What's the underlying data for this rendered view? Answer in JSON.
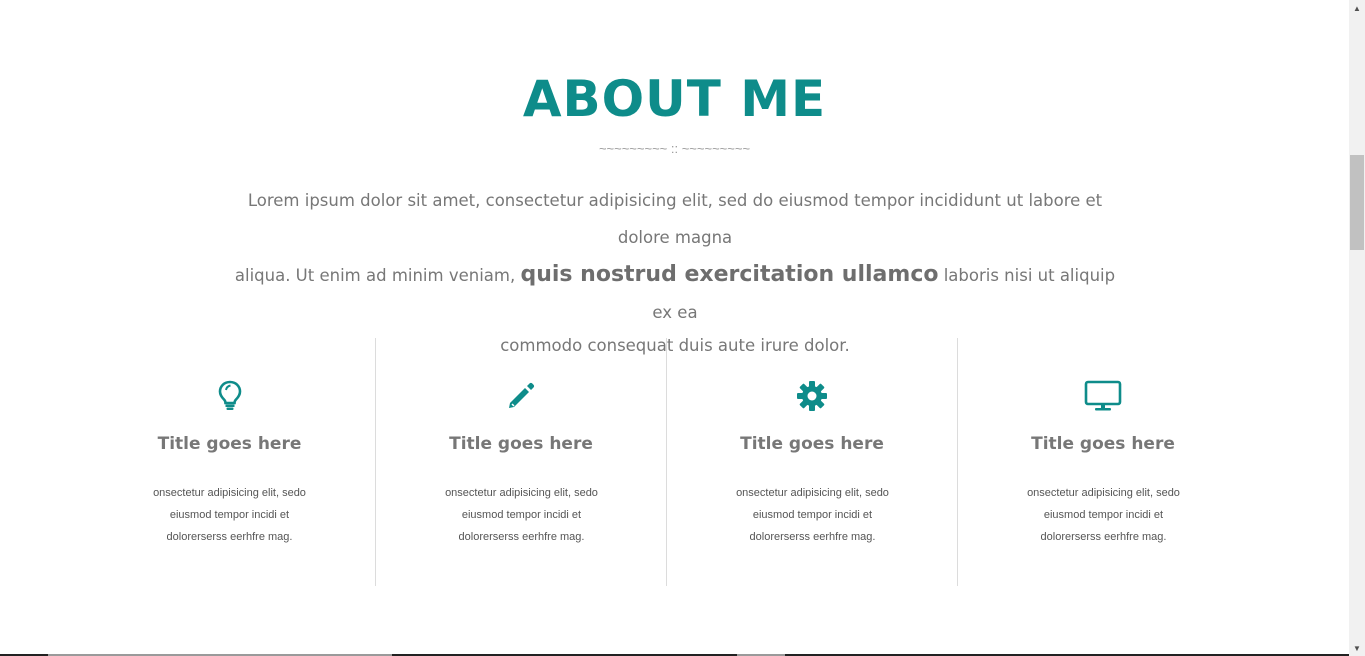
{
  "section": {
    "title": "ABOUT ME",
    "divider": "~~~~~~~~~ :: ~~~~~~~~~",
    "intro_line1": "Lorem ipsum dolor sit amet, consectetur adipisicing elit, sed do eiusmod tempor incididunt ut labore et dolore magna",
    "intro_line2_pre": "aliqua. Ut enim ad minim veniam, ",
    "intro_line2_strong": "quis nostrud exercitation ullamco",
    "intro_line2_post": " laboris nisi ut aliquip ex ea",
    "intro_line3": "commodo consequat duis aute irure dolor."
  },
  "features": [
    {
      "icon": "lightbulb-icon",
      "title": "Title goes here",
      "desc": "onsectetur adipisicing elit, sedo eiusmod tempor incidi et dolorerserss eerhfre mag."
    },
    {
      "icon": "pencil-icon",
      "title": "Title goes here",
      "desc": "onsectetur adipisicing elit, sedo eiusmod tempor incidi et dolorerserss eerhfre mag."
    },
    {
      "icon": "gear-icon",
      "title": "Title goes here",
      "desc": "onsectetur adipisicing elit, sedo eiusmod tempor incidi et dolorerserss eerhfre mag."
    },
    {
      "icon": "monitor-icon",
      "title": "Title goes here",
      "desc": "onsectetur adipisicing elit, sedo eiusmod tempor incidi et dolorerserss eerhfre mag."
    }
  ],
  "colors": {
    "accent": "#0e8c8a",
    "text": "#777777",
    "divider": "#dcdcdc"
  }
}
